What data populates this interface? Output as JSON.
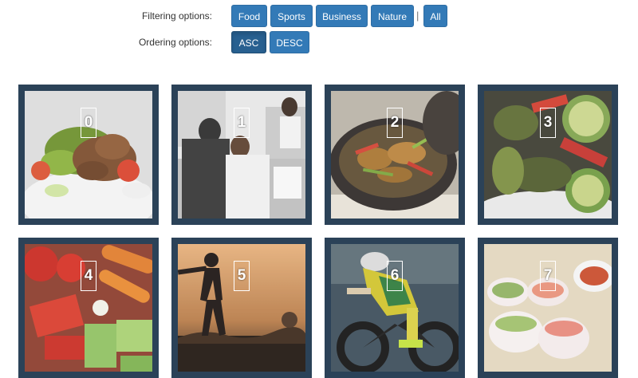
{
  "filter": {
    "label": "Filtering options:",
    "buttons": [
      "Food",
      "Sports",
      "Business",
      "Nature"
    ],
    "separator": "|",
    "all": "All"
  },
  "order": {
    "label": "Ordering options:",
    "buttons": [
      "ASC",
      "DESC"
    ],
    "active": "ASC"
  },
  "colors": {
    "button": "#337ab7",
    "button_active": "#286090",
    "tile_frame": "#2b4258"
  },
  "gallery": {
    "items": [
      {
        "number": "0",
        "subject": "food-salad"
      },
      {
        "number": "1",
        "subject": "business-meeting"
      },
      {
        "number": "2",
        "subject": "food-stir-fry"
      },
      {
        "number": "3",
        "subject": "food-roasted-vegetables"
      },
      {
        "number": "4",
        "subject": "food-vegetables"
      },
      {
        "number": "5",
        "subject": "sports-runner"
      },
      {
        "number": "6",
        "subject": "sports-cyclist"
      },
      {
        "number": "7",
        "subject": "food-spring-rolls"
      }
    ]
  }
}
